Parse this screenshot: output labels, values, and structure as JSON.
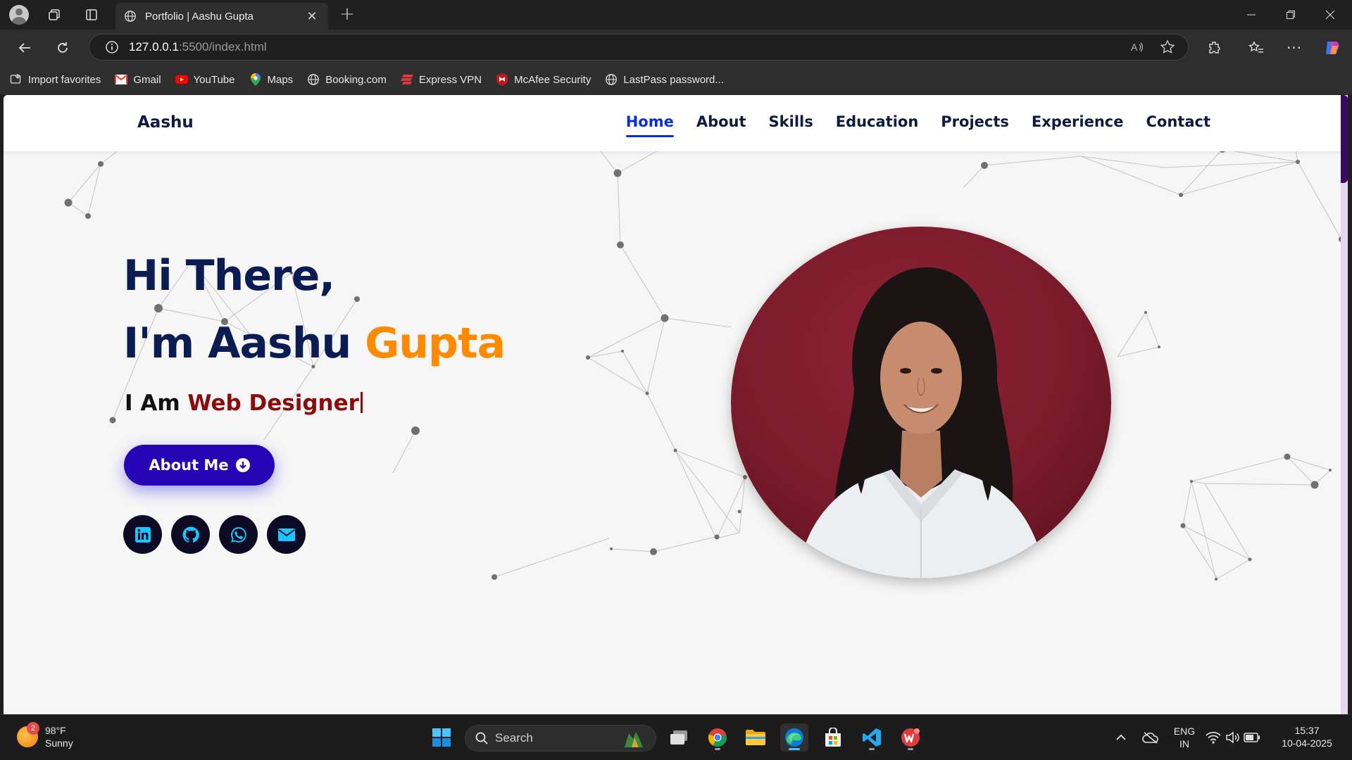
{
  "browser": {
    "tab_title": "Portfolio | Aashu Gupta",
    "url_host": "127.0.0.1",
    "url_rest": ":5500/index.html",
    "favorites": [
      {
        "label": "Import favorites",
        "icon": "import-icon"
      },
      {
        "label": "Gmail",
        "icon": "gmail-icon"
      },
      {
        "label": "YouTube",
        "icon": "youtube-icon"
      },
      {
        "label": "Maps",
        "icon": "maps-icon"
      },
      {
        "label": "Booking.com",
        "icon": "globe-icon"
      },
      {
        "label": "Express VPN",
        "icon": "expressvpn-icon"
      },
      {
        "label": "McAfee Security",
        "icon": "mcafee-icon"
      },
      {
        "label": "LastPass password...",
        "icon": "globe-icon"
      }
    ]
  },
  "site": {
    "logo": "Aashu",
    "menu": [
      "Home",
      "About",
      "Skills",
      "Education",
      "Projects",
      "Experience",
      "Contact"
    ],
    "active_menu": "Home",
    "hero": {
      "line1": "Hi There,",
      "line2_prefix": "I'm Aashu",
      "line2_accent": "Gupta",
      "line3_prefix": "I Am",
      "line3_role": "Web Designer"
    },
    "about_button": "About Me",
    "socials": [
      "linkedin-icon",
      "github-icon",
      "whatsapp-icon",
      "email-icon"
    ],
    "colors": {
      "primary_text": "#0b1c52",
      "accent_orange": "#ff8a00",
      "role_red": "#8a0c0c",
      "button_blue": "#2505b4",
      "active_link": "#0a2fd6"
    }
  },
  "taskbar": {
    "weather_temp": "98°F",
    "weather_desc": "Sunny",
    "weather_badge": "2",
    "search_placeholder": "Search",
    "lang_top": "ENG",
    "lang_bottom": "IN",
    "time": "15:37",
    "date": "10-04-2025"
  }
}
